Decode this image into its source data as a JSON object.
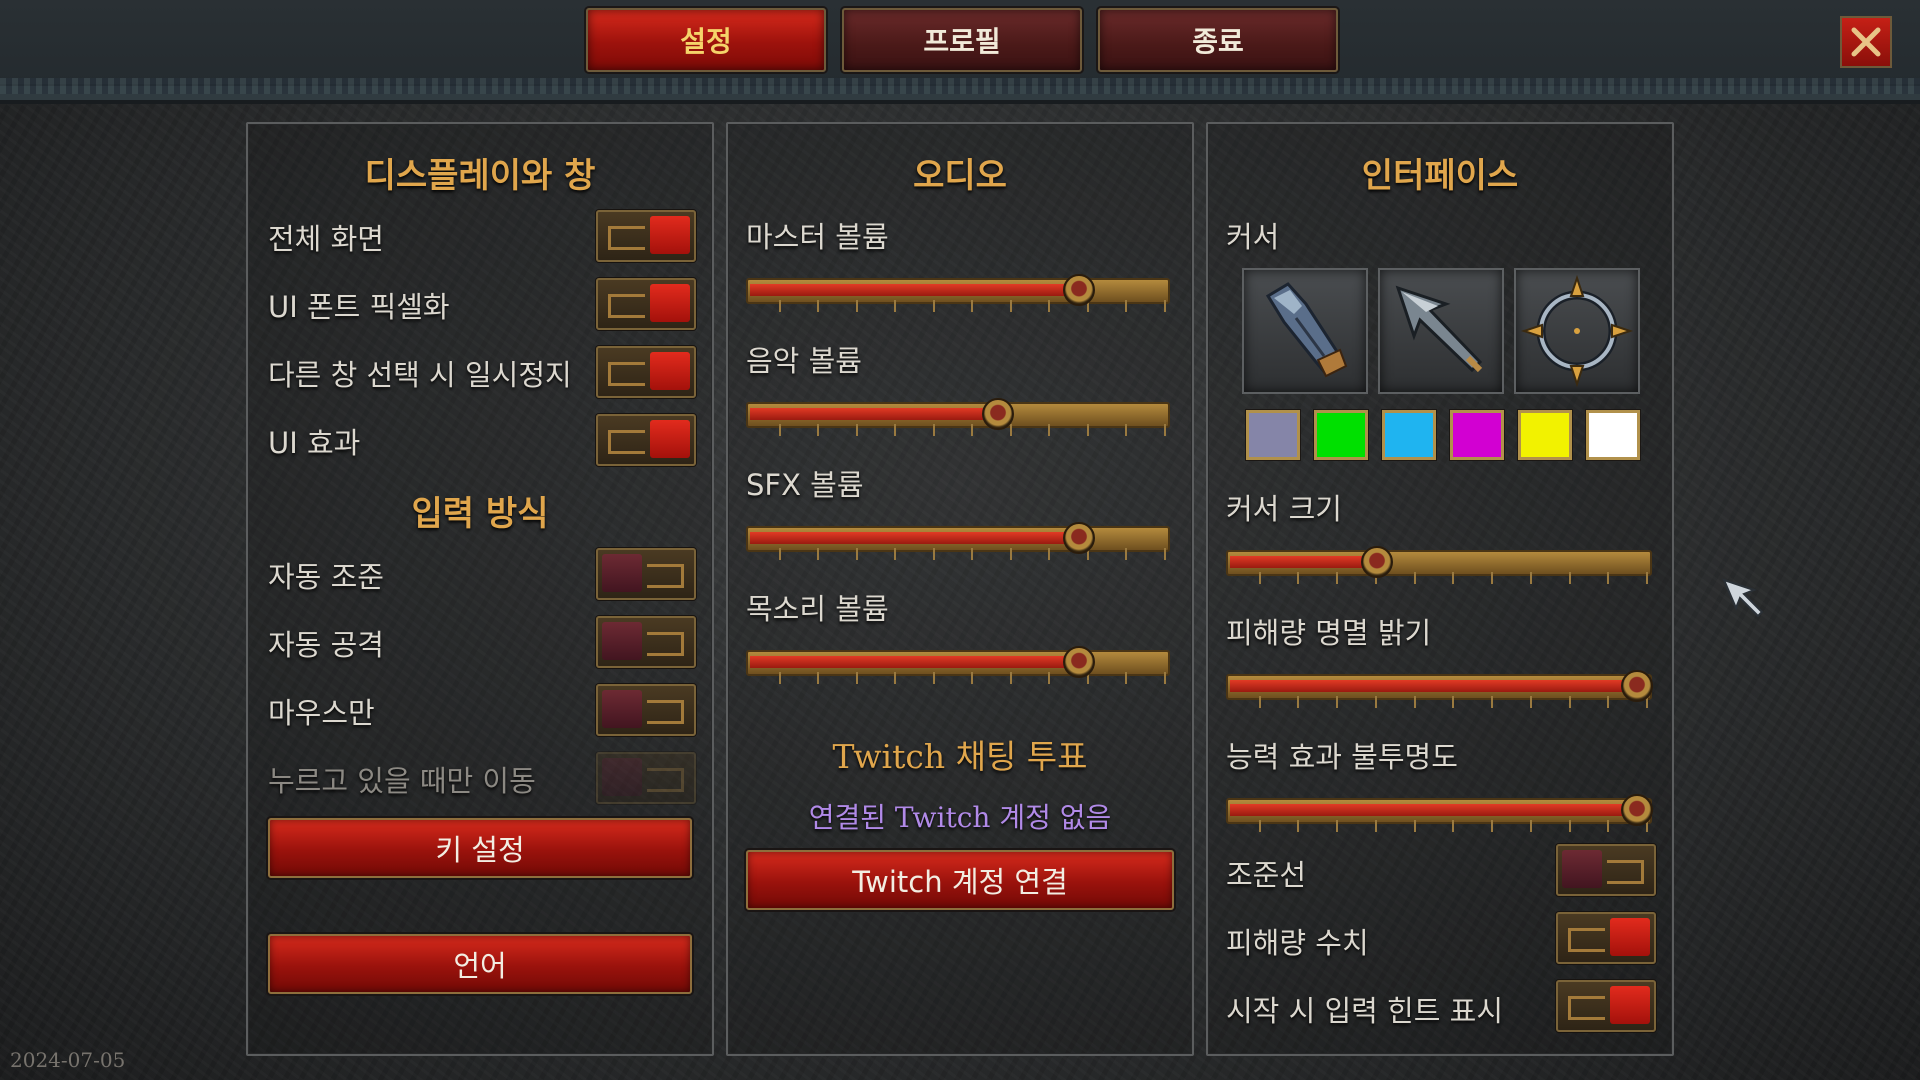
{
  "tabs": [
    {
      "label": "설정",
      "active": true
    },
    {
      "label": "프로필",
      "active": false
    },
    {
      "label": "종료",
      "active": false
    }
  ],
  "close_icon": "close-x-icon",
  "display": {
    "title": "디스플레이와 창",
    "rows": [
      {
        "label": "전체 화면",
        "on": true
      },
      {
        "label": "UI 폰트 픽셀화",
        "on": true
      },
      {
        "label": "다른 창 선택 시 일시정지",
        "on": true
      },
      {
        "label": "UI 효과",
        "on": true
      }
    ],
    "input_title": "입력 방식",
    "input_rows": [
      {
        "label": "자동 조준",
        "on": false
      },
      {
        "label": "자동 공격",
        "on": false
      },
      {
        "label": "마우스만",
        "on": false
      },
      {
        "label": "누르고 있을 때만 이동",
        "on": false,
        "disabled": true
      }
    ],
    "keybind_button": "키 설정",
    "language_button": "언어"
  },
  "audio": {
    "title": "오디오",
    "sliders": [
      {
        "label": "마스터 볼륨",
        "value": 0.78
      },
      {
        "label": "음악 볼륨",
        "value": 0.59
      },
      {
        "label": "SFX 볼륨",
        "value": 0.78
      },
      {
        "label": "목소리 볼륨",
        "value": 0.78
      }
    ],
    "twitch_title": "Twitch 채팅 투표",
    "twitch_status": "연결된 Twitch 계정 없음",
    "twitch_button": "Twitch 계정 연결"
  },
  "interface": {
    "title": "인터페이스",
    "cursor_label": "커서",
    "cursor_icons": [
      "gauntlet-cursor-icon",
      "arrow-cursor-icon",
      "crosshair-cursor-icon"
    ],
    "cursor_colors": [
      "#8585a8",
      "#00e000",
      "#1fb4f0",
      "#d200d2",
      "#f2f200",
      "#ffffff"
    ],
    "sliders": [
      {
        "label": "커서 크기",
        "value": 0.35
      },
      {
        "label": "피해량 명멸 밝기",
        "value": 0.96
      },
      {
        "label": "능력 효과 불투명도",
        "value": 0.96
      }
    ],
    "toggles": [
      {
        "label": "조준선",
        "on": false
      },
      {
        "label": "피해량 수치",
        "on": true
      },
      {
        "label": "시작 시 입력 힌트 표시",
        "on": true
      }
    ]
  },
  "footer": {
    "date": "2024-07-05"
  },
  "colors": {
    "title_gold": "#e0a64c",
    "accent_red": "#c52016",
    "twitch_purple": "#b18ae8"
  }
}
